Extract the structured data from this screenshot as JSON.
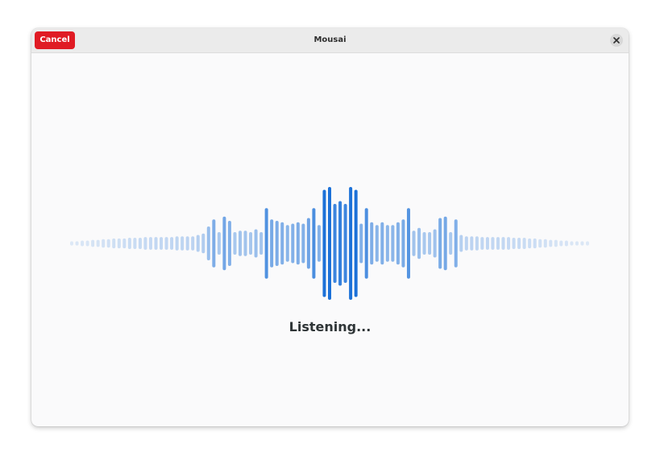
{
  "window": {
    "title": "Mousai",
    "cancel_label": "Cancel",
    "close_icon": "close-icon"
  },
  "status": {
    "text": "Listening..."
  },
  "waveform": {
    "accent_color": "#1c71d8",
    "levels": [
      0.03,
      0.03,
      0.04,
      0.04,
      0.05,
      0.05,
      0.06,
      0.06,
      0.07,
      0.07,
      0.07,
      0.08,
      0.08,
      0.08,
      0.09,
      0.09,
      0.09,
      0.09,
      0.09,
      0.09,
      0.1,
      0.1,
      0.1,
      0.1,
      0.12,
      0.14,
      0.24,
      0.34,
      0.16,
      0.38,
      0.32,
      0.16,
      0.18,
      0.18,
      0.16,
      0.2,
      0.16,
      0.5,
      0.34,
      0.32,
      0.3,
      0.26,
      0.28,
      0.3,
      0.28,
      0.36,
      0.5,
      0.26,
      0.76,
      0.8,
      0.56,
      0.6,
      0.56,
      0.8,
      0.76,
      0.28,
      0.5,
      0.3,
      0.26,
      0.3,
      0.26,
      0.26,
      0.3,
      0.34,
      0.5,
      0.18,
      0.22,
      0.16,
      0.16,
      0.2,
      0.36,
      0.38,
      0.16,
      0.34,
      0.12,
      0.1,
      0.1,
      0.1,
      0.09,
      0.09,
      0.09,
      0.09,
      0.09,
      0.09,
      0.08,
      0.08,
      0.08,
      0.07,
      0.07,
      0.06,
      0.06,
      0.05,
      0.05,
      0.04,
      0.04,
      0.03,
      0.03,
      0.03,
      0.03
    ]
  }
}
